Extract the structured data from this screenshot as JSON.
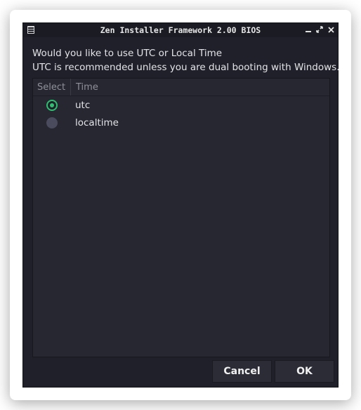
{
  "window": {
    "title": "Zen Installer Framework 2.00 BIOS",
    "controls": [
      "minimize-icon",
      "restore-icon",
      "close-icon"
    ]
  },
  "message": {
    "line1": "Would you like to use UTC or Local Time",
    "line2": "UTC is recommended unless you are dual booting with Windows."
  },
  "table": {
    "columns": [
      "Select",
      "Time"
    ],
    "rows": [
      {
        "selected": true,
        "time": "utc"
      },
      {
        "selected": false,
        "time": "localtime"
      }
    ]
  },
  "buttons": {
    "cancel": "Cancel",
    "ok": "OK"
  },
  "colors": {
    "accent": "#2fbf71",
    "background": "#1f2029"
  }
}
